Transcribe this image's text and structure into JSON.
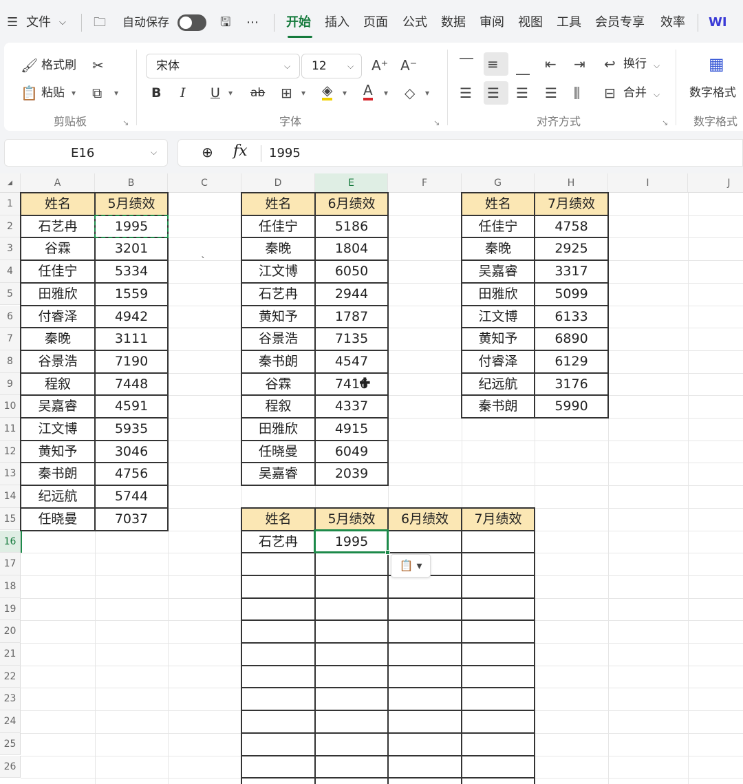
{
  "menubar": {
    "hamburger_icon": "menu-icon",
    "file_label": "文件",
    "autosave_label": "自动保存",
    "tabs": [
      "开始",
      "插入",
      "页面",
      "公式",
      "数据",
      "审阅",
      "视图",
      "工具",
      "会员专享",
      "效率"
    ],
    "active_tab": "开始",
    "brand_label": "WI"
  },
  "ribbon": {
    "format_painter": "格式刷",
    "paste": "粘贴",
    "clipboard_group": "剪贴板",
    "font_name": "宋体",
    "font_size": "12",
    "font_group": "字体",
    "bold": "B",
    "italic": "I",
    "underline": "U",
    "strike": "ab",
    "wrap_text": "换行",
    "merge": "合并",
    "align_group": "对齐方式",
    "number_format": "数字格式",
    "number_group": "数字格式"
  },
  "formula_bar": {
    "cell_ref": "E16",
    "fx": "fx",
    "value": "1995"
  },
  "grid": {
    "columns": [
      "A",
      "B",
      "C",
      "D",
      "E",
      "F",
      "G",
      "H",
      "I",
      "J"
    ],
    "rows": [
      "1",
      "2",
      "3",
      "4",
      "5",
      "6",
      "7",
      "8",
      "9",
      "10",
      "11",
      "12",
      "13",
      "14",
      "15",
      "16",
      "17",
      "18",
      "19",
      "20",
      "21",
      "22",
      "23",
      "24",
      "25",
      "26"
    ],
    "selected_cell": "E16"
  },
  "table_may": {
    "headers": [
      "姓名",
      "5月绩效"
    ],
    "rows": [
      [
        "石艺冉",
        "1995"
      ],
      [
        "谷霖",
        "3201"
      ],
      [
        "任佳宁",
        "5334"
      ],
      [
        "田雅欣",
        "1559"
      ],
      [
        "付睿泽",
        "4942"
      ],
      [
        "秦晚",
        "3111"
      ],
      [
        "谷景浩",
        "7190"
      ],
      [
        "程叙",
        "7448"
      ],
      [
        "吴嘉睿",
        "4591"
      ],
      [
        "江文博",
        "5935"
      ],
      [
        "黄知予",
        "3046"
      ],
      [
        "秦书朗",
        "4756"
      ],
      [
        "纪远航",
        "5744"
      ],
      [
        "任晓曼",
        "7037"
      ]
    ]
  },
  "table_june": {
    "headers": [
      "姓名",
      "6月绩效"
    ],
    "rows": [
      [
        "任佳宁",
        "5186"
      ],
      [
        "秦晚",
        "1804"
      ],
      [
        "江文博",
        "6050"
      ],
      [
        "石艺冉",
        "2944"
      ],
      [
        "黄知予",
        "1787"
      ],
      [
        "谷景浩",
        "7135"
      ],
      [
        "秦书朗",
        "4547"
      ],
      [
        "谷霖",
        "7416"
      ],
      [
        "程叙",
        "4337"
      ],
      [
        "田雅欣",
        "4915"
      ],
      [
        "任晓曼",
        "6049"
      ],
      [
        "吴嘉睿",
        "2039"
      ]
    ]
  },
  "table_july": {
    "headers": [
      "姓名",
      "7月绩效"
    ],
    "rows": [
      [
        "任佳宁",
        "4758"
      ],
      [
        "秦晚",
        "2925"
      ],
      [
        "吴嘉睿",
        "3317"
      ],
      [
        "田雅欣",
        "5099"
      ],
      [
        "江文博",
        "6133"
      ],
      [
        "黄知予",
        "6890"
      ],
      [
        "付睿泽",
        "6129"
      ],
      [
        "纪远航",
        "3176"
      ],
      [
        "秦书朗",
        "5990"
      ]
    ]
  },
  "table_summary": {
    "headers": [
      "姓名",
      "5月绩效",
      "6月绩效",
      "7月绩效"
    ],
    "rows": [
      [
        "石艺冉",
        "1995",
        "",
        ""
      ]
    ]
  }
}
